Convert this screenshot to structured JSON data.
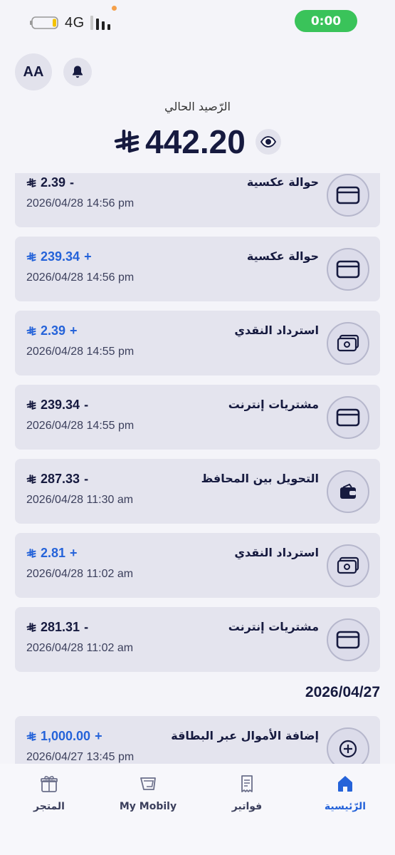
{
  "status_bar": {
    "network": "4G",
    "time": "0:00",
    "battery_level": 0.2
  },
  "header": {
    "avatar_initials": "AA",
    "balance_label": "الرّصيد الحالي",
    "balance_amount": "442.20"
  },
  "colors": {
    "accent": "#2563d9",
    "dark_text": "#161a3f",
    "card_bg": "#e4e4ee",
    "status_green": "#3ac35a"
  },
  "transactions": [
    {
      "title": "حوالة عكسية",
      "sign": "-",
      "amount": "2.39",
      "type": "debit",
      "date": "2026/04/28 14:56 pm",
      "icon": "card-icon"
    },
    {
      "title": "حوالة عكسية",
      "sign": "+",
      "amount": "239.34",
      "type": "credit",
      "date": "2026/04/28 14:56 pm",
      "icon": "card-icon"
    },
    {
      "title": "استرداد النقدي",
      "sign": "+",
      "amount": "2.39",
      "type": "credit",
      "date": "2026/04/28 14:55 pm",
      "icon": "cash-icon"
    },
    {
      "title": "مشتريات إنترنت",
      "sign": "-",
      "amount": "239.34",
      "type": "debit",
      "date": "2026/04/28 14:55 pm",
      "icon": "card-icon"
    },
    {
      "title": "التحويل بين المحافظ",
      "sign": "-",
      "amount": "287.33",
      "type": "debit",
      "date": "2026/04/28 11:30 am",
      "icon": "wallet-icon"
    },
    {
      "title": "استرداد النقدي",
      "sign": "+",
      "amount": "2.81",
      "type": "credit",
      "date": "2026/04/28 11:02 am",
      "icon": "cash-icon"
    },
    {
      "title": "مشتريات إنترنت",
      "sign": "-",
      "amount": "281.31",
      "type": "debit",
      "date": "2026/04/28 11:02 am",
      "icon": "card-icon"
    }
  ],
  "date_group": "2026/04/27",
  "transactions_group2": [
    {
      "title": "إضافة الأموال عبر البطاقة",
      "sign": "+",
      "amount": "1,000.00",
      "type": "credit",
      "date": "2026/04/27 13:45 pm",
      "icon": "plus-circle-icon"
    }
  ],
  "bottom_nav": [
    {
      "label": "المتجر",
      "icon": "gift-icon",
      "active": false
    },
    {
      "label": "My Mobily",
      "icon": "mobily-logo-icon",
      "active": false
    },
    {
      "label": "فواتير",
      "icon": "receipt-icon",
      "active": false
    },
    {
      "label": "الرّئيسية",
      "icon": "home-icon",
      "active": true
    }
  ]
}
